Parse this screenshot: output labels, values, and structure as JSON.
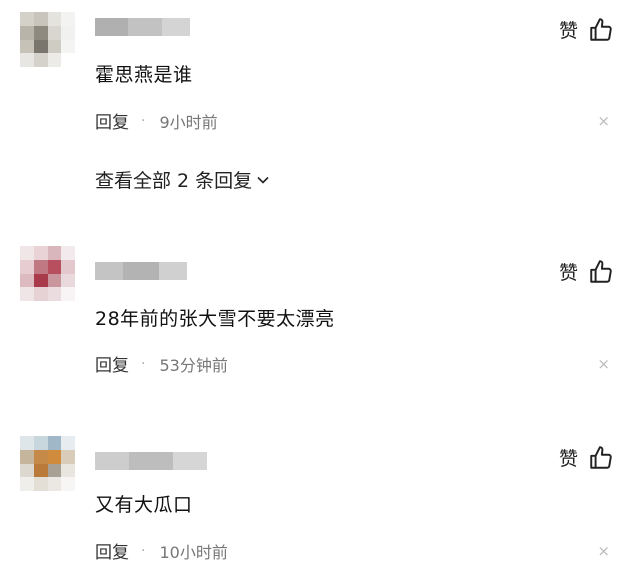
{
  "like_label": "赞",
  "reply_label": "回复",
  "separator": "·",
  "close_symbol": "×",
  "view_all_replies": "查看全部 2 条回复",
  "comments": [
    {
      "text": "霍思燕是谁",
      "time": "9小时前"
    },
    {
      "text": "28年前的张大雪不要太漂亮",
      "time": "53分钟前"
    },
    {
      "text": "又有大瓜口",
      "time": "10小时前"
    }
  ],
  "colors": {
    "text": "#222222",
    "muted": "#777777",
    "close": "#bbbbbb"
  },
  "icons": {
    "like": "thumbs-up-icon",
    "expand": "chevron-down-icon",
    "close": "close-icon"
  }
}
